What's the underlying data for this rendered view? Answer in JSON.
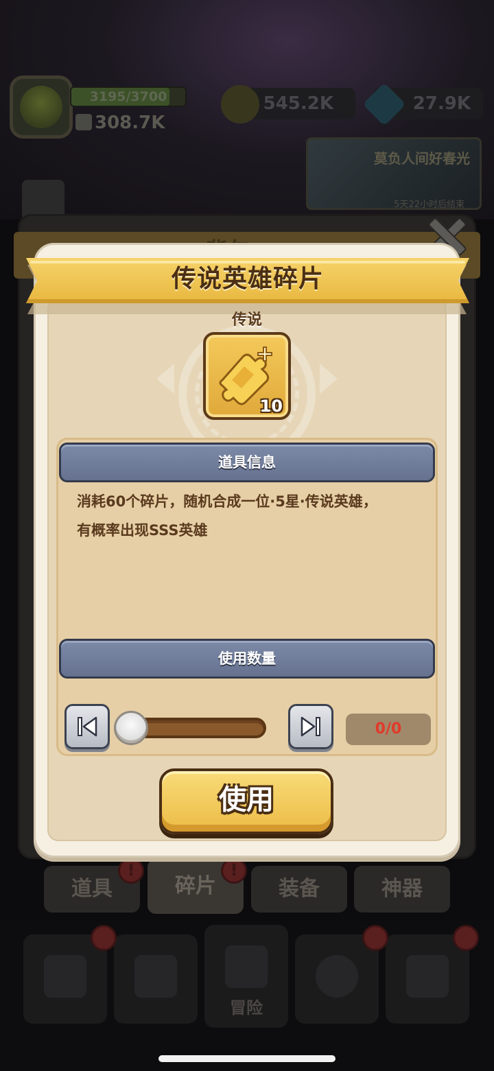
{
  "hud": {
    "xp_text": "3195/3700",
    "xp_fraction": 0.863,
    "power": "308.7K",
    "gold": "545.2K",
    "gems": "27.9K"
  },
  "event_banner": {
    "title": "莫负人间好春光",
    "subtitle": "5天22小时后结束"
  },
  "backpack": {
    "title": "背包",
    "tabs": [
      {
        "label": "道具",
        "badge": "!"
      },
      {
        "label": "碎片",
        "badge": "!",
        "active": true
      },
      {
        "label": "装备"
      },
      {
        "label": "神器"
      }
    ]
  },
  "bottom_nav": {
    "items": [
      {
        "label": ""
      },
      {
        "label": ""
      },
      {
        "label": "冒险"
      },
      {
        "label": ""
      },
      {
        "label": ""
      }
    ]
  },
  "modal": {
    "title": "传说英雄碎片",
    "rarity": "传说",
    "item_count": "10",
    "info_header": "道具信息",
    "description": [
      "消耗60个碎片，随机合成一位·5星·传说英雄，",
      "有概率出现SSS英雄"
    ],
    "quantity_header": "使用数量",
    "quantity_text": "0/0",
    "use_label": "使用"
  },
  "colors": {
    "ribbon": "#f6d36a",
    "section_bar": "#7c8aa8",
    "quantity_text": "#e03a2a",
    "use_button": "#f8db78"
  }
}
